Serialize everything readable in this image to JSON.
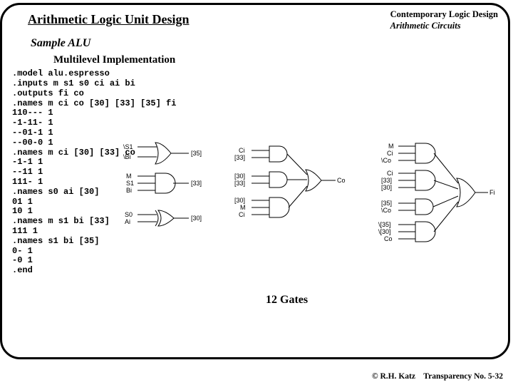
{
  "header": {
    "title": "Arithmetic Logic Unit Design",
    "right_line1": "Contemporary Logic Design",
    "right_line2": "Arithmetic Circuits"
  },
  "subtitles": {
    "sample": "Sample ALU",
    "multilevel": "Multilevel Implementation"
  },
  "code": ".model alu.espresso\n.inputs m s1 s0 ci ai bi\n.outputs fi co\n.names m ci co [30] [33] [35] fi\n110--- 1\n-1-11- 1\n--01-1 1\n--00-0 1\n.names m ci [30] [33] co\n-1-1 1\n--11 1\n111- 1\n.names s0 ai [30]\n01 1\n10 1\n.names m s1 bi [33]\n111 1\n.names s1 bi [35]\n0- 1\n-0 1\n.end",
  "diagram": {
    "left_block": {
      "inputs_top": [
        "\\S1",
        "\\Bi"
      ],
      "inputs_mid": [
        "M",
        "S1",
        "Bi"
      ],
      "inputs_bot": [
        "S0",
        "Ai"
      ],
      "out_top": "[35]",
      "out_mid": "[33]",
      "out_bot": "[30]"
    },
    "mid_block": {
      "ands": [
        {
          "inputs": [
            "Ci",
            "[33]"
          ]
        },
        {
          "inputs": [
            "[30]",
            "[33]"
          ]
        },
        {
          "inputs": [
            "[30]",
            "M",
            "Ci"
          ]
        }
      ],
      "or_out": "Co"
    },
    "right_block": {
      "ands": [
        {
          "inputs": [
            "M",
            "Ci",
            "\\Co"
          ]
        },
        {
          "inputs": [
            "Ci",
            "[33]",
            "[30]"
          ]
        },
        {
          "inputs": [
            "[35]",
            "\\Co"
          ]
        },
        {
          "inputs": [
            "\\[35]",
            "\\[30]",
            "Co"
          ]
        }
      ],
      "or_out": "Fi"
    }
  },
  "gate_count_label": "12 Gates",
  "footer": {
    "copyright": "© R.H. Katz",
    "transparency": "Transparency No. 5-32"
  }
}
